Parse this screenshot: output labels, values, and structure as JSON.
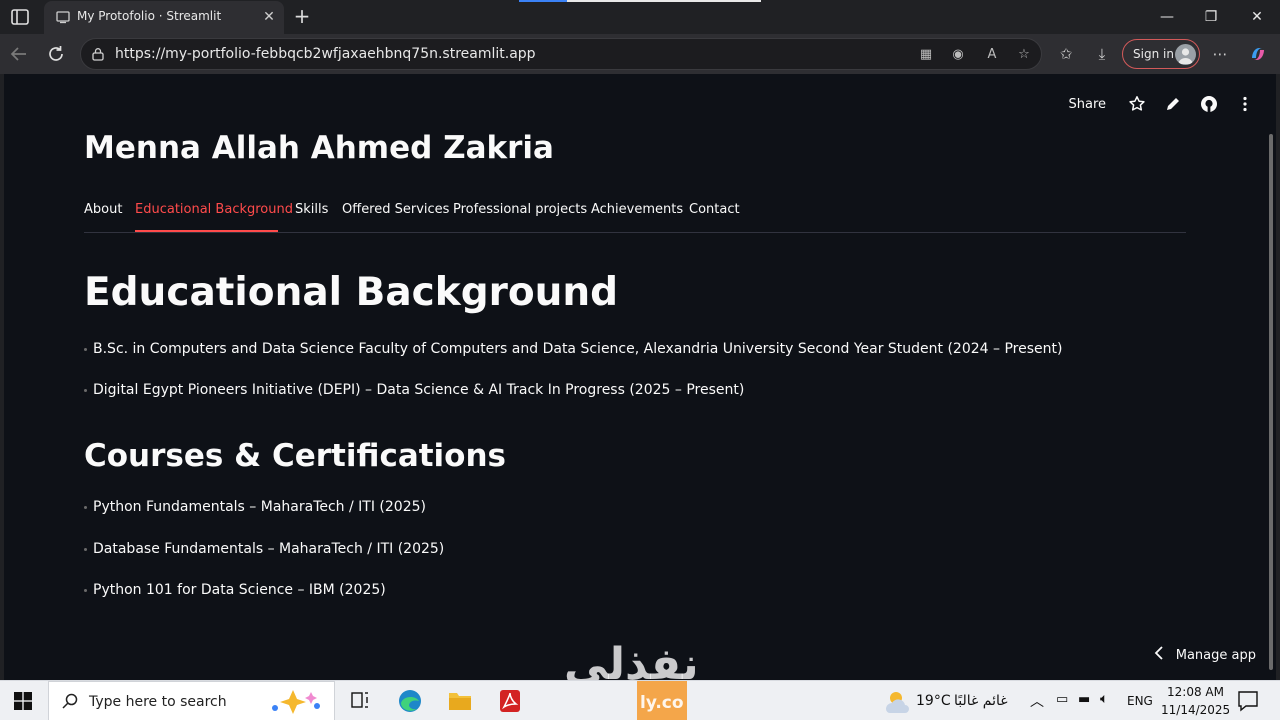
{
  "browser": {
    "tab_title": "My Protofolio · Streamlit",
    "url": "https://my-portfolio-febbqcb2wfjaxaehbnq75n.streamlit.app",
    "sign_in_label": "Sign in"
  },
  "app_header": {
    "share_label": "Share"
  },
  "page": {
    "name": "Menna Allah Ahmed Zakria",
    "tabs": [
      {
        "label": "About"
      },
      {
        "label": "Educational Background",
        "active": true
      },
      {
        "label": "Skills"
      },
      {
        "label": "Offered Services"
      },
      {
        "label": "Professional projects"
      },
      {
        "label": "Achievements"
      },
      {
        "label": "Contact"
      }
    ],
    "education_heading": "Educational Background",
    "education": [
      "B.Sc. in Computers and Data Science Faculty of Computers and Data Science, Alexandria University Second Year Student (2024 – Present)",
      "Digital Egypt Pioneers Initiative (DEPI) – Data Science & AI Track In Progress (2025 – Present)"
    ],
    "courses_heading": "Courses & Certifications",
    "courses": [
      "Python Fundamentals – MaharaTech / ITI (2025)",
      "Database Fundamentals – MaharaTech / ITI (2025)",
      "Python 101 for Data Science – IBM (2025)"
    ],
    "manage_app_label": "Manage app",
    "watermark": "نفذلي",
    "watermark_sub": "ly.co"
  },
  "taskbar": {
    "search_placeholder": "Type here to search",
    "weather_temp": "19°C",
    "weather_text": "غائم غالبًا",
    "language": "ENG",
    "time": "12:08 AM",
    "date": "11/14/2025"
  },
  "colors": {
    "accent": "#ff4b4b",
    "page_bg": "#0e1117",
    "browser_bg": "#202124"
  }
}
